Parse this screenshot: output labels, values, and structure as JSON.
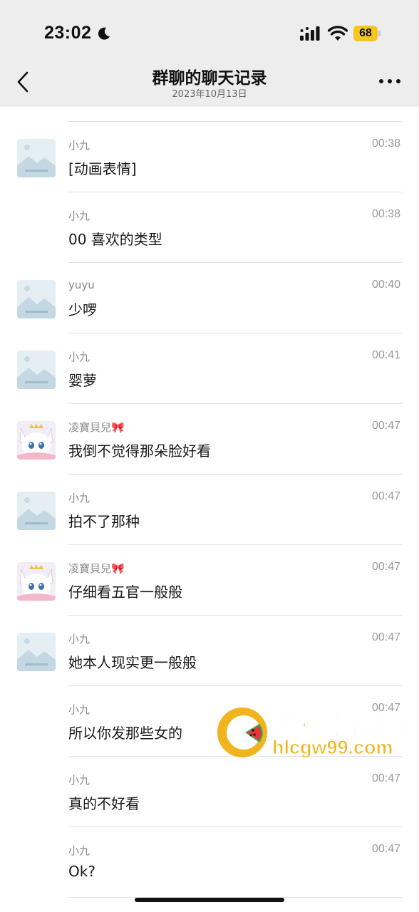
{
  "status_bar": {
    "time": "23:02",
    "battery": "68"
  },
  "nav": {
    "title": "群聊的聊天记录",
    "subtitle": "2023年10月13日"
  },
  "messages": [
    {
      "name": "小九",
      "time": "00:38",
      "text": "[动画表情]",
      "avatar": "placeholder-image-icon"
    },
    {
      "name": "小九",
      "time": "00:38",
      "text": "00 喜欢的类型",
      "avatar": ""
    },
    {
      "name": "yuyu",
      "time": "00:40",
      "text": "少啰",
      "avatar": "placeholder-image-icon"
    },
    {
      "name": "小九",
      "time": "00:41",
      "text": "婴萝",
      "avatar": "placeholder-image-icon"
    },
    {
      "name": "凌寶貝兒🎀",
      "time": "00:47",
      "text": "我倒不觉得那朵脸好看",
      "avatar": "anime-character-avatar"
    },
    {
      "name": "小九",
      "time": "00:47",
      "text": "拍不了那种",
      "avatar": "placeholder-image-icon"
    },
    {
      "name": "凌寶貝兒🎀",
      "time": "00:47",
      "text": "仔细看五官一般般",
      "avatar": "anime-character-avatar"
    },
    {
      "name": "小九",
      "time": "00:47",
      "text": "她本人现实更一般般",
      "avatar": "placeholder-image-icon"
    },
    {
      "name": "小九",
      "time": "00:47",
      "text": "所以你发那些女的",
      "avatar": ""
    },
    {
      "name": "小九",
      "time": "00:47",
      "text": "真的不好看",
      "avatar": ""
    },
    {
      "name": "小九",
      "time": "00:47",
      "text": "Ok?",
      "avatar": ""
    }
  ],
  "watermark": {
    "title": "黑料吃瓜网",
    "url": "hlcgw99.com"
  },
  "colors": {
    "header_bg": "#ededed",
    "battery": "#f3c623",
    "watermark": "#f0b51e"
  }
}
